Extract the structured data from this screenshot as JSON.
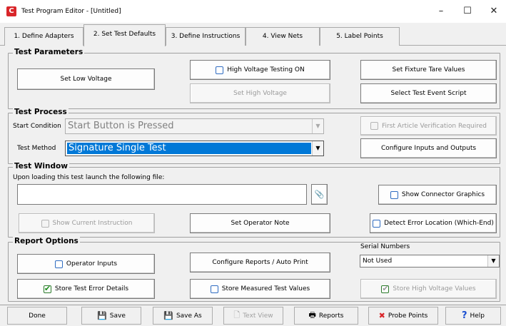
{
  "window": {
    "title": "Test Program Editor - [Untitled]",
    "minimize": "–",
    "maximize": "☐",
    "close": "✕"
  },
  "tabs": [
    {
      "label": "1. Define Adapters"
    },
    {
      "label": "2. Set Test Defaults",
      "active": true
    },
    {
      "label": "3. Define Instructions"
    },
    {
      "label": "4. View Nets"
    },
    {
      "label": "5. Label Points"
    }
  ],
  "test_parameters": {
    "legend": "Test Parameters",
    "set_low_voltage": "Set Low Voltage",
    "high_voltage_on": "High Voltage Testing ON",
    "high_voltage_on_checked": false,
    "set_high_voltage": "Set High Voltage",
    "set_fixture_tare": "Set Fixture Tare Values",
    "select_test_event_script": "Select Test Event Script"
  },
  "test_process": {
    "legend": "Test Process",
    "start_condition_label": "Start Condition",
    "start_condition_value": "Start Button is Pressed",
    "test_method_label": "Test Method",
    "test_method_value": "Signature Single Test",
    "first_article": "First Article Verification Required",
    "first_article_checked": false,
    "configure_io": "Configure Inputs and Outputs"
  },
  "test_window": {
    "legend": "Test Window",
    "launch_label": "Upon loading this test launch the following file:",
    "launch_file_value": "",
    "browse_icon": "attach-icon",
    "show_connector_graphics": "Show Connector Graphics",
    "show_connector_graphics_checked": false,
    "show_current_instruction": "Show Current Instruction",
    "show_current_instruction_checked": false,
    "set_operator_note": "Set Operator Note",
    "detect_error_location": "Detect Error Location (Which-End)",
    "detect_error_location_checked": false
  },
  "report_options": {
    "legend": "Report Options",
    "operator_inputs": "Operator Inputs",
    "operator_inputs_checked": false,
    "configure_reports": "Configure Reports / Auto Print",
    "serial_numbers_label": "Serial Numbers",
    "serial_numbers_value": "Not Used",
    "store_test_error_details": "Store Test Error Details",
    "store_test_error_details_checked": true,
    "store_measured_test_values": "Store Measured Test Values",
    "store_measured_test_values_checked": false,
    "store_high_voltage_values": "Store High Voltage Values",
    "store_high_voltage_values_checked": true
  },
  "toolbar": {
    "done": "Done",
    "save": "Save",
    "save_as": "Save As",
    "text_view": "Text View",
    "reports": "Reports",
    "probe_points": "Probe Points",
    "help": "Help"
  },
  "colors": {
    "app_icon": "#d9262a",
    "selection": "#0078d7",
    "checkbox_border": "#2f6cc1",
    "check_green": "#1d8c1d"
  }
}
